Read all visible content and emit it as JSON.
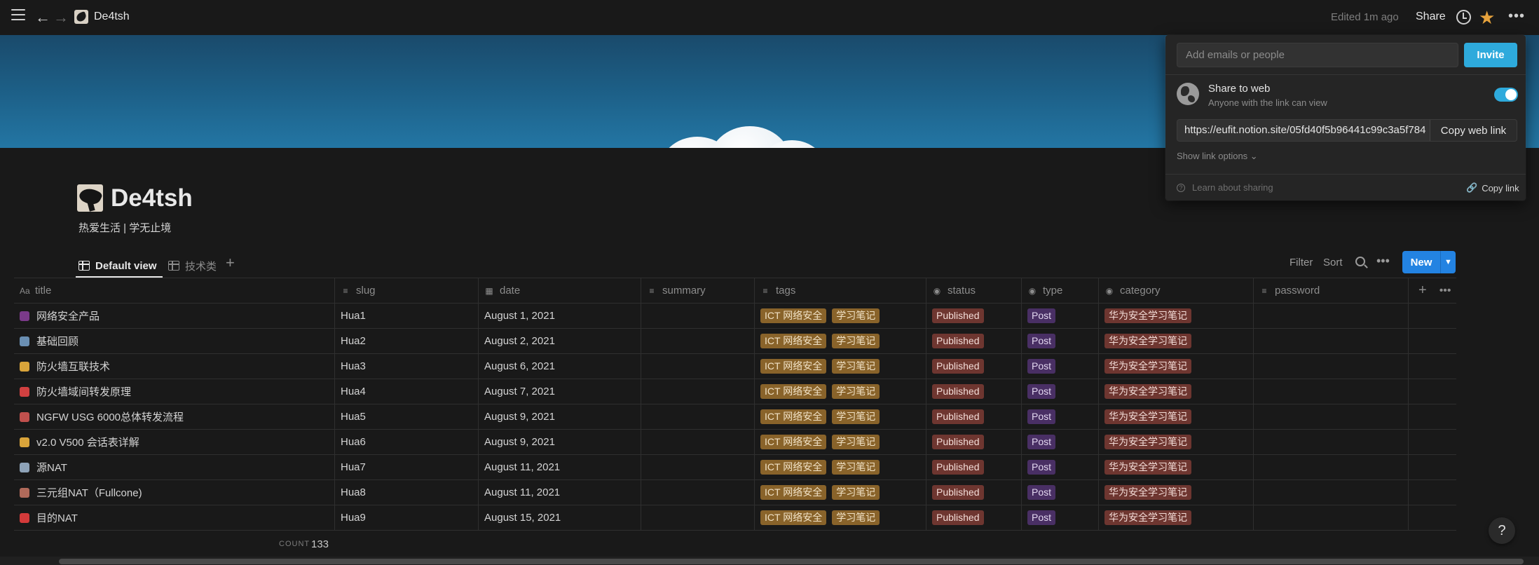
{
  "topbar": {
    "title": "De4tsh",
    "edited": "Edited 1m ago",
    "share": "Share"
  },
  "page": {
    "title": "De4tsh",
    "subtitle": "热爱生活 | 学无止境"
  },
  "views": {
    "tabs": [
      {
        "label": "Default view"
      },
      {
        "label": "技术类"
      }
    ],
    "filter": "Filter",
    "sort": "Sort",
    "new": "New"
  },
  "table": {
    "columns": [
      {
        "label": "title",
        "icon": "Aa"
      },
      {
        "label": "slug",
        "icon": "≡"
      },
      {
        "label": "date",
        "icon": "▦"
      },
      {
        "label": "summary",
        "icon": "≡"
      },
      {
        "label": "tags",
        "icon": "≡"
      },
      {
        "label": "status",
        "icon": "◉"
      },
      {
        "label": "type",
        "icon": "◉"
      },
      {
        "label": "category",
        "icon": "◉"
      },
      {
        "label": "password",
        "icon": "≡"
      }
    ],
    "rows": [
      {
        "title": "网络安全产品",
        "slug": "Hua1",
        "date": "August 1, 2021",
        "icon_color": "#7b3a8a"
      },
      {
        "title": "基础回顾",
        "slug": "Hua2",
        "date": "August 2, 2021",
        "icon_color": "#6a8fb3"
      },
      {
        "title": "防火墙互联技术",
        "slug": "Hua3",
        "date": "August 6, 2021",
        "icon_color": "#d9a43a"
      },
      {
        "title": "防火墙域间转发原理",
        "slug": "Hua4",
        "date": "August 7, 2021",
        "icon_color": "#d04040"
      },
      {
        "title": "NGFW USG 6000总体转发流程",
        "slug": "Hua5",
        "date": "August 9, 2021",
        "icon_color": "#c0504d"
      },
      {
        "title": "v2.0 V500 会话表详解",
        "slug": "Hua6",
        "date": "August 9, 2021",
        "icon_color": "#d9a43a"
      },
      {
        "title": "源NAT",
        "slug": "Hua7",
        "date": "August 11, 2021",
        "icon_color": "#8ea3b8"
      },
      {
        "title": "三元组NAT（Fullcone)",
        "slug": "Hua8",
        "date": "August 11, 2021",
        "icon_color": "#b06a5a"
      },
      {
        "title": "目的NAT",
        "slug": "Hua9",
        "date": "August 15, 2021",
        "icon_color": "#d43a3a"
      }
    ],
    "tags": [
      "ICT 网络安全",
      "学习笔记"
    ],
    "status": "Published",
    "type": "Post",
    "category": "华为安全学习笔记",
    "count_label": "COUNT",
    "count": "133"
  },
  "share_popover": {
    "placeholder": "Add emails or people",
    "invite": "Invite",
    "share_to_web": "Share to web",
    "share_sub": "Anyone with the link can view",
    "url": "https://eufit.notion.site/05fd40f5b96441c99c3a5f784",
    "copy_web_link": "Copy web link",
    "link_options": "Show link options ⌄",
    "learn": "Learn about sharing",
    "copy_link": "Copy link"
  },
  "help": "?"
}
